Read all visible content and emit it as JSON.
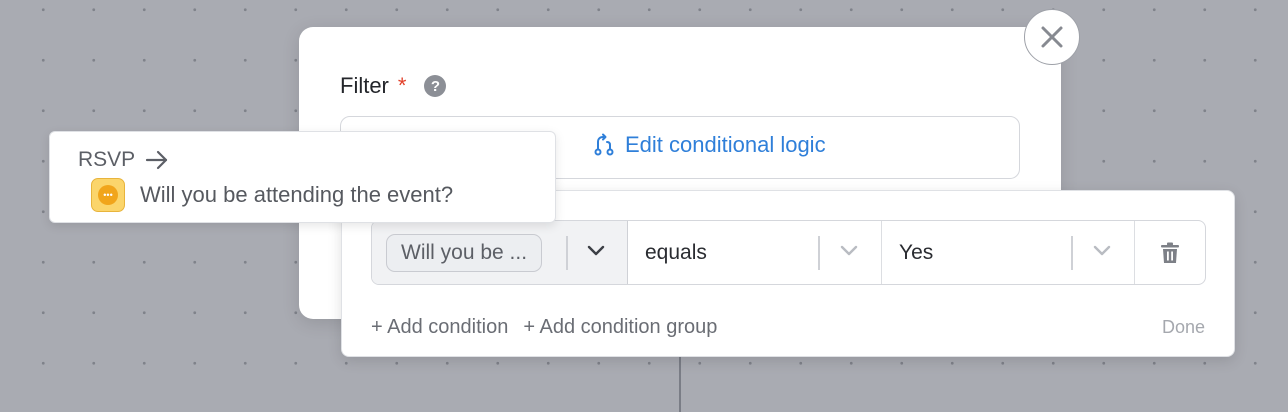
{
  "modal": {
    "filter_label": "Filter",
    "required_mark": "*",
    "help_glyph": "?",
    "edit_logic_label": "Edit conditional logic"
  },
  "rsvp_card": {
    "title": "RSVP",
    "question": "Will you be attending the event?",
    "question_icon_glyph": "•••",
    "question_icon": "dots-bubble-icon"
  },
  "condition_panel": {
    "rows": [
      {
        "field": "Will you be ...",
        "operator": "equals",
        "value": "Yes"
      }
    ],
    "add_condition": "+ Add condition",
    "add_condition_group": "+ Add condition group",
    "done": "Done"
  },
  "colors": {
    "accent": "#2f7fd9",
    "required": "#e2402a",
    "canvas": "#a9abb2",
    "question_icon": "#fbd56b"
  }
}
